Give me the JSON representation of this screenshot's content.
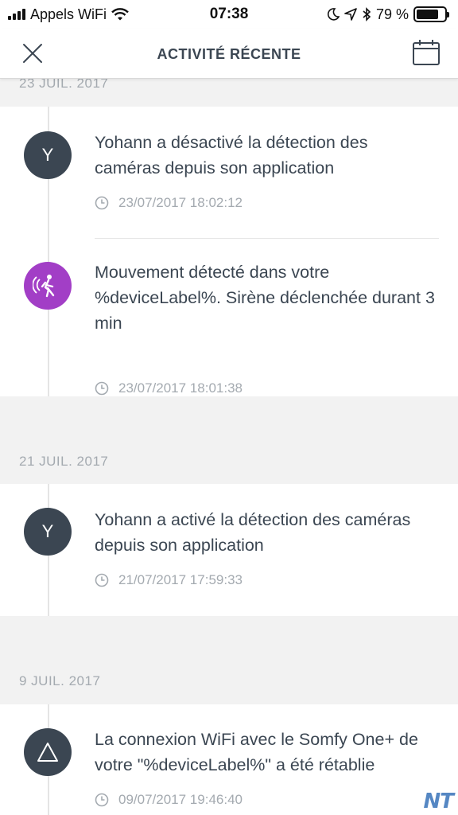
{
  "status_bar": {
    "carrier": "Appels WiFi",
    "time": "07:38",
    "battery": "79 %",
    "battery_level": 0.79
  },
  "header": {
    "title": "ACTIVITÉ RÉCENTE"
  },
  "groups": [
    {
      "date": "23 JUIL. 2017",
      "events": [
        {
          "avatar": "Y",
          "icon": "user-avatar",
          "text": "Yohann a désactivé la détection des caméras depuis son application",
          "time": "23/07/2017 18:02:12"
        },
        {
          "avatar": "",
          "icon": "motion-sensor-icon",
          "text": "Mouvement détecté dans votre %deviceLabel%. Sirène déclenchée durant 3 min",
          "time": "23/07/2017 18:01:38"
        }
      ]
    },
    {
      "date": "21 JUIL. 2017",
      "events": [
        {
          "avatar": "Y",
          "icon": "user-avatar",
          "text": "Yohann a activé la détection des caméras depuis son application",
          "time": "21/07/2017 17:59:33"
        }
      ]
    },
    {
      "date": "9 JUIL. 2017",
      "events": [
        {
          "avatar": "",
          "icon": "warning-triangle-icon",
          "text": "La connexion WiFi avec le Somfy One+ de votre \"%deviceLabel%\" a été rétablie",
          "time": "09/07/2017 19:46:40"
        }
      ]
    }
  ],
  "watermark": "NT",
  "colors": {
    "avatar_dark": "#3b4652",
    "avatar_motion": "#a23ec6",
    "muted_text": "#a4aab0",
    "background": "#f2f2f2"
  }
}
